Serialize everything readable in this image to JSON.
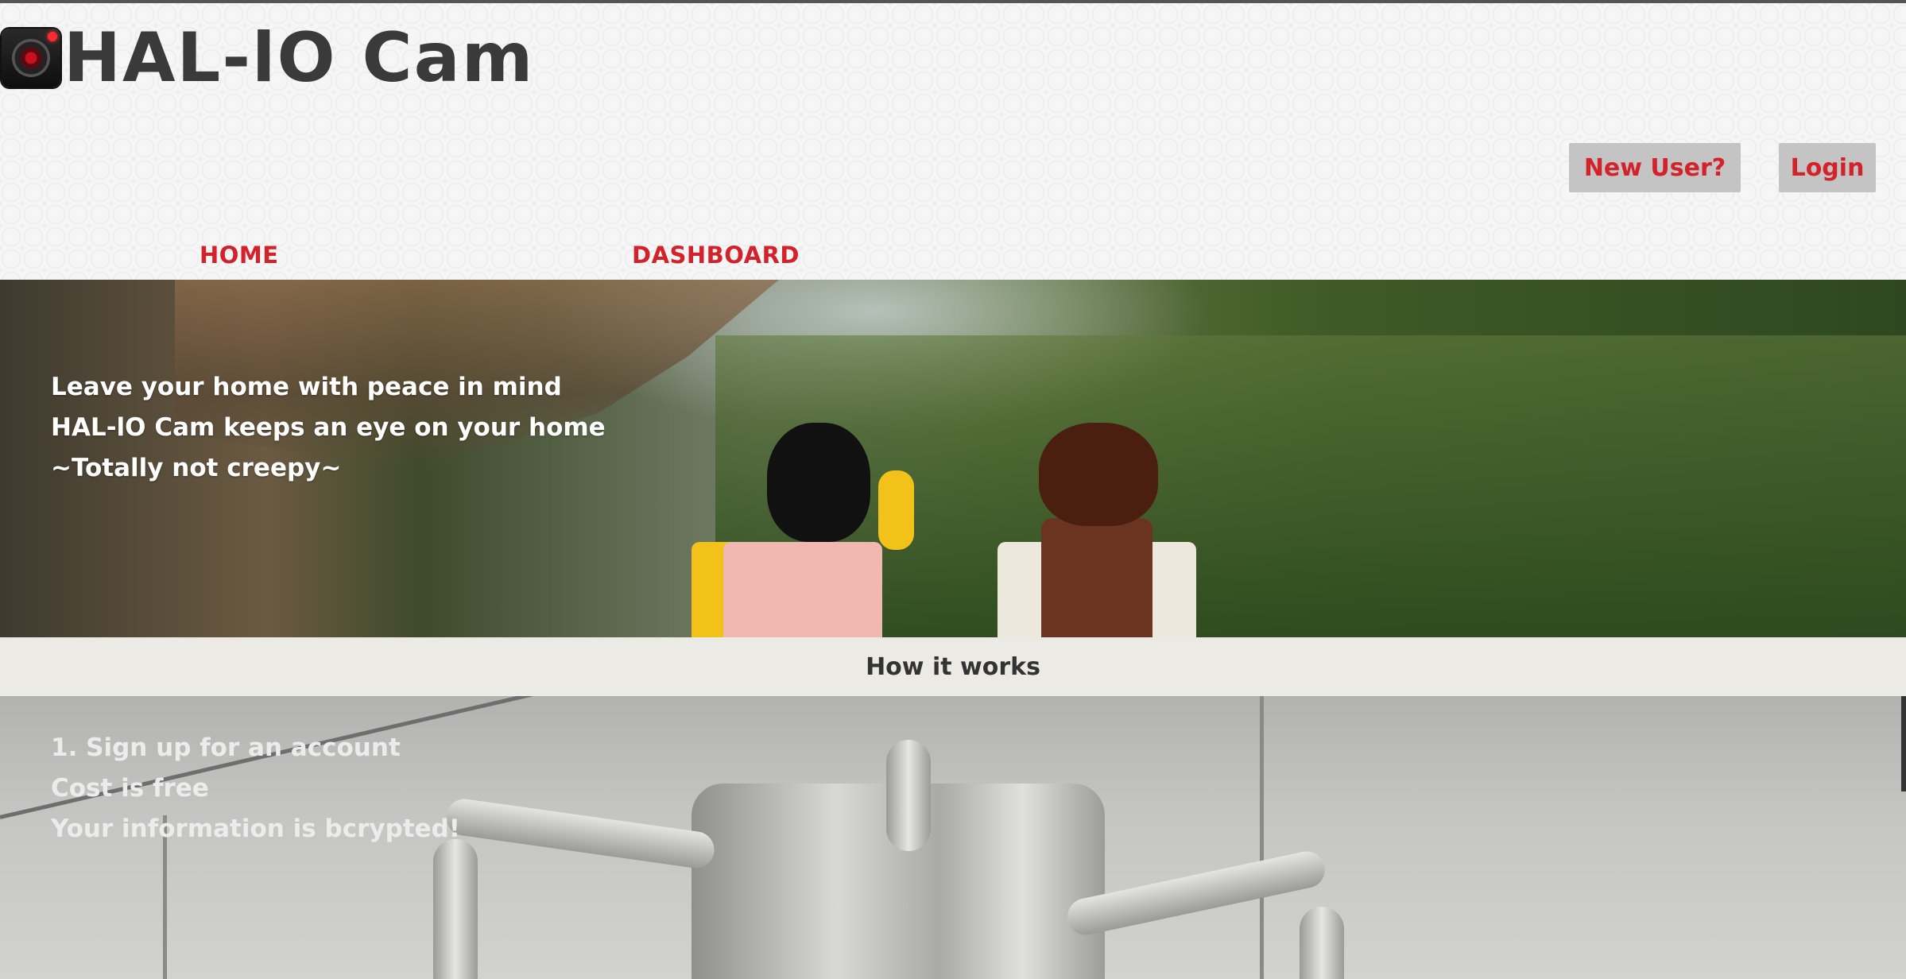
{
  "header": {
    "brand": "HAL-lO Cam",
    "logo_icon": "camera-lens-icon",
    "buttons": {
      "new_user": "New User?",
      "login": "Login"
    },
    "nav": {
      "home": "HOME",
      "dashboard": "DASHBOARD"
    }
  },
  "hero": {
    "lines": [
      "Leave your home with peace in mind",
      "HAL-lO Cam keeps an eye on your home",
      "~Totally not creepy~"
    ]
  },
  "how_it_works": {
    "title": "How it works"
  },
  "step1": {
    "lines": [
      "1. Sign up for an account",
      "Cost is free",
      "Your information is bcrypted!"
    ]
  },
  "colors": {
    "accent": "#d3222a",
    "button_bg": "#c4c4c4",
    "brand_text": "#3a3a3a"
  }
}
